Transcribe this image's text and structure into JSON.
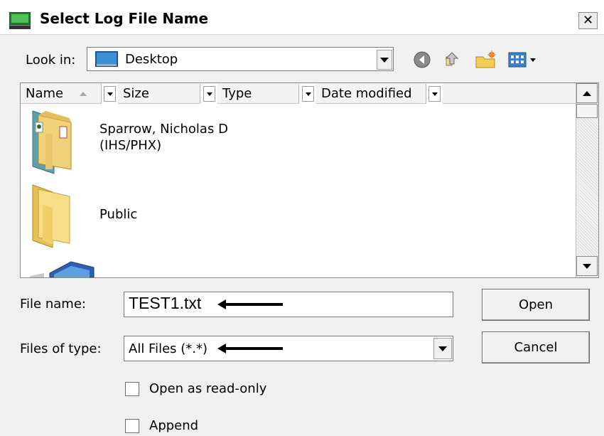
{
  "window": {
    "title": "Select Log File Name",
    "close_glyph": "✕"
  },
  "lookin": {
    "label": "Look in:",
    "value": "Desktop",
    "icon": "desktop-icon"
  },
  "toolbar": {
    "icons": [
      "back-icon",
      "up-folder-icon",
      "new-folder-icon",
      "view-menu-icon"
    ]
  },
  "columns": [
    "Name",
    "Size",
    "Type",
    "Date modified"
  ],
  "items": [
    {
      "label_line1": "Sparrow, Nicholas D",
      "label_line2": "(IHS/PHX)",
      "icon": "user-folder-icon"
    },
    {
      "label_line1": "Public",
      "label_line2": "",
      "icon": "folder-icon"
    },
    {
      "label_line1": "",
      "label_line2": "",
      "icon": "computer-icon"
    }
  ],
  "form": {
    "filename_label": "File name:",
    "filename_value": "TEST1.txt",
    "filetype_label": "Files of type:",
    "filetype_value": "All Files (*.*)",
    "open_label": "Open",
    "cancel_label": "Cancel",
    "readonly_label": "Open as read-only",
    "append_label": "Append",
    "readonly_checked": false,
    "append_checked": false
  }
}
